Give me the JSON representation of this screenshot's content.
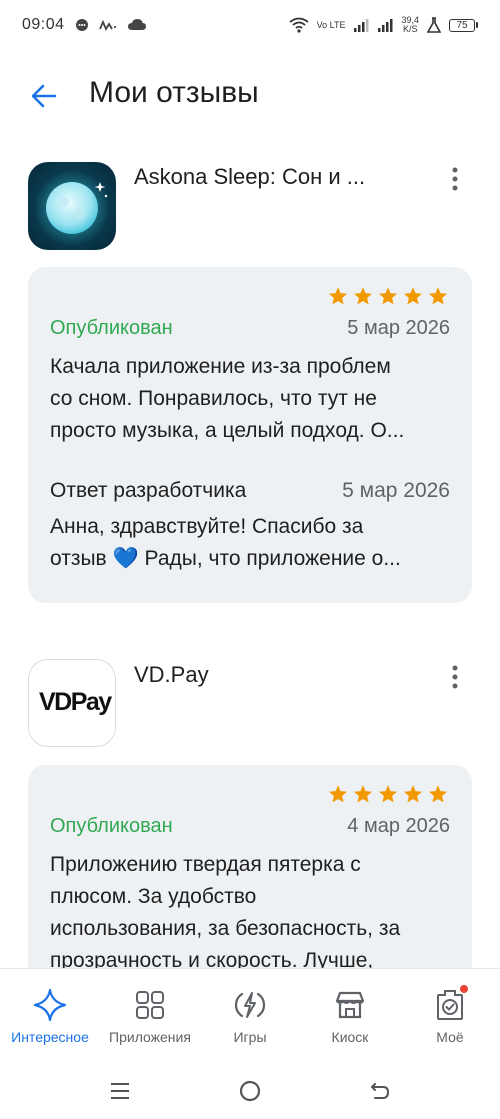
{
  "status_bar": {
    "time": "09:04",
    "network_label": "Vo LTE",
    "speed_value": "39,4",
    "speed_unit": "K/S",
    "battery": "75"
  },
  "header": {
    "title": "Мои отзывы"
  },
  "reviews": [
    {
      "app_name": "Askona Sleep: Сон и ...",
      "rating": 5,
      "status": "Опубликован",
      "date": "5 мар 2026",
      "text_lines": [
        "Качала приложение из-за проблем",
        "со сном. Понравилось, что тут не",
        "просто музыка, а целый подход. О..."
      ],
      "dev_label": "Ответ разработчика",
      "dev_date": "5 мар 2026",
      "dev_lines": [
        "Анна, здравствуйте! Спасибо за",
        "отзыв 💙 Рады, что приложение о..."
      ]
    },
    {
      "app_name": "VD.Pay",
      "icon_logo_text": "VDPay",
      "rating": 5,
      "status": "Опубликован",
      "date": "4 мар 2026",
      "text_lines": [
        "Приложению твердая пятерка с",
        "плюсом. За удобство",
        "использования, за безопасность, за",
        "прозрачность и скорость. Лучше,"
      ]
    }
  ],
  "bottom_nav": [
    {
      "label": "Интересное",
      "icon": "sparkle-icon",
      "active": true
    },
    {
      "label": "Приложения",
      "icon": "apps-grid-icon",
      "active": false
    },
    {
      "label": "Игры",
      "icon": "game-icon",
      "active": false
    },
    {
      "label": "Киоск",
      "icon": "kiosk-icon",
      "active": false
    },
    {
      "label": "Моё",
      "icon": "profile-icon",
      "active": false
    }
  ],
  "colors": {
    "accent": "#1a73e8",
    "star": "#f29900",
    "published": "#32a852",
    "card_bg": "#eef1f4"
  }
}
